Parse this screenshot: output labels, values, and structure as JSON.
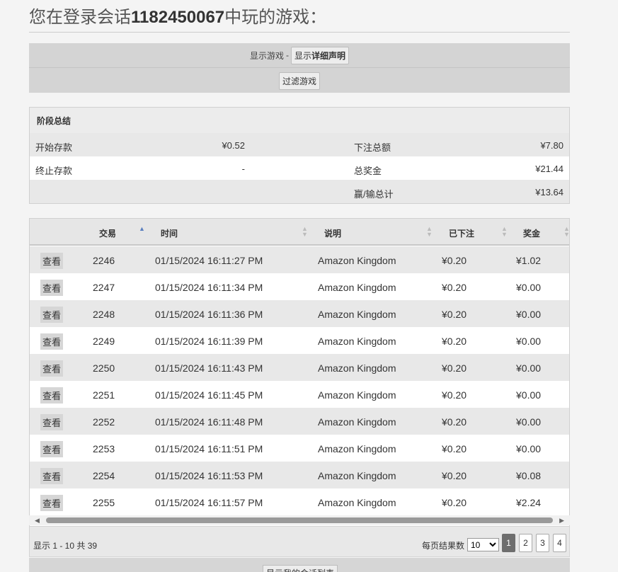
{
  "header": {
    "title_prefix": "您在登录会话",
    "session_id": "1182450067",
    "title_suffix": "中玩的游戏："
  },
  "filter": {
    "show_games_label": "显示游戏",
    "separator": "-",
    "show_details_prefix": "显示",
    "show_details_bold": "详细声明",
    "filter_button": "过滤游戏"
  },
  "summary": {
    "title": "阶段总结",
    "start_balance_label": "开始存款",
    "start_balance_value": "¥0.52",
    "end_balance_label": "终止存款",
    "end_balance_value": "-",
    "total_bet_label": "下注总额",
    "total_bet_value": "¥7.80",
    "total_win_label": "总奖金",
    "total_win_value": "¥21.44",
    "net_label": "赢/输总计",
    "net_value": "¥13.64"
  },
  "table": {
    "headers": {
      "transaction": "交易",
      "time": "时间",
      "description": "说明",
      "bet": "已下注",
      "win": "奖金"
    },
    "view_label": "查看",
    "rows": [
      {
        "id": "2246",
        "time": "01/15/2024 16:11:27 PM",
        "desc": "Amazon Kingdom",
        "bet": "¥0.20",
        "win": "¥1.02"
      },
      {
        "id": "2247",
        "time": "01/15/2024 16:11:34 PM",
        "desc": "Amazon Kingdom",
        "bet": "¥0.20",
        "win": "¥0.00"
      },
      {
        "id": "2248",
        "time": "01/15/2024 16:11:36 PM",
        "desc": "Amazon Kingdom",
        "bet": "¥0.20",
        "win": "¥0.00"
      },
      {
        "id": "2249",
        "time": "01/15/2024 16:11:39 PM",
        "desc": "Amazon Kingdom",
        "bet": "¥0.20",
        "win": "¥0.00"
      },
      {
        "id": "2250",
        "time": "01/15/2024 16:11:43 PM",
        "desc": "Amazon Kingdom",
        "bet": "¥0.20",
        "win": "¥0.00"
      },
      {
        "id": "2251",
        "time": "01/15/2024 16:11:45 PM",
        "desc": "Amazon Kingdom",
        "bet": "¥0.20",
        "win": "¥0.00"
      },
      {
        "id": "2252",
        "time": "01/15/2024 16:11:48 PM",
        "desc": "Amazon Kingdom",
        "bet": "¥0.20",
        "win": "¥0.00"
      },
      {
        "id": "2253",
        "time": "01/15/2024 16:11:51 PM",
        "desc": "Amazon Kingdom",
        "bet": "¥0.20",
        "win": "¥0.00"
      },
      {
        "id": "2254",
        "time": "01/15/2024 16:11:53 PM",
        "desc": "Amazon Kingdom",
        "bet": "¥0.20",
        "win": "¥0.08"
      },
      {
        "id": "2255",
        "time": "01/15/2024 16:11:57 PM",
        "desc": "Amazon Kingdom",
        "bet": "¥0.20",
        "win": "¥2.24"
      }
    ]
  },
  "footer": {
    "info": "显示 1 - 10 共 39",
    "per_page_label": "每页结果数",
    "per_page_value": "10",
    "pages": [
      "1",
      "2",
      "3",
      "4"
    ],
    "current_page": "1",
    "bottom_button": "显示我的会话列表"
  },
  "icons": {
    "sort_asc": "sort-ascending-icon",
    "sort_both": "sort-both-icon",
    "scroll_left": "scroll-left-arrow-icon",
    "scroll_right": "scroll-right-arrow-icon"
  },
  "colors": {
    "page_bg": "#f4f4f4",
    "panel_bg": "#d4d4d4",
    "row_alt": "#e8e8e8",
    "active_page": "#6e6e6e",
    "sort_active": "#5a7fbf"
  }
}
